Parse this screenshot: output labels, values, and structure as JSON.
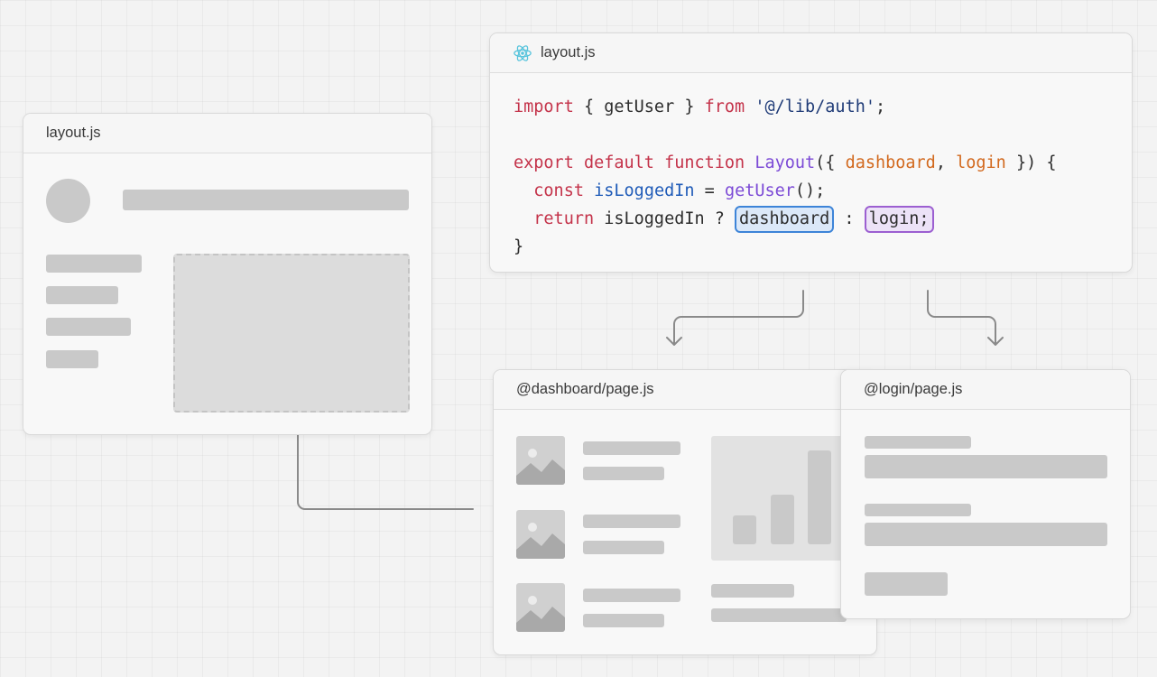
{
  "left_card": {
    "title": "layout.js"
  },
  "code_card": {
    "title": "layout.js",
    "icon": "react-icon",
    "lines": {
      "l1_import": "import",
      "l1_a": " { getUser } ",
      "l1_from": "from",
      "l1_sp": " ",
      "l1_str": "'@/lib/auth'",
      "l1_end": ";",
      "l3_export": "export",
      "l3_sp1": " ",
      "l3_default": "default",
      "l3_sp2": " ",
      "l3_function": "function",
      "l3_sp3": " ",
      "l3_name": "Layout",
      "l3_open": "({ ",
      "l3_p1": "dashboard",
      "l3_comma": ", ",
      "l3_p2": "login",
      "l3_close": " }) {",
      "l4_indent": "  ",
      "l4_const": "const",
      "l4_sp": " ",
      "l4_var": "isLoggedIn",
      "l4_eq": " = ",
      "l4_fn": "getUser",
      "l4_end": "();",
      "l5_indent": "  ",
      "l5_return": "return",
      "l5_rest": " isLoggedIn ? ",
      "l5_dashboard": "dashboard",
      "l5_colon": " : ",
      "l5_login": "login;",
      "l6": "}"
    }
  },
  "dashboard_card": {
    "title": "@dashboard/page.js"
  },
  "login_card": {
    "title": "@login/page.js"
  }
}
